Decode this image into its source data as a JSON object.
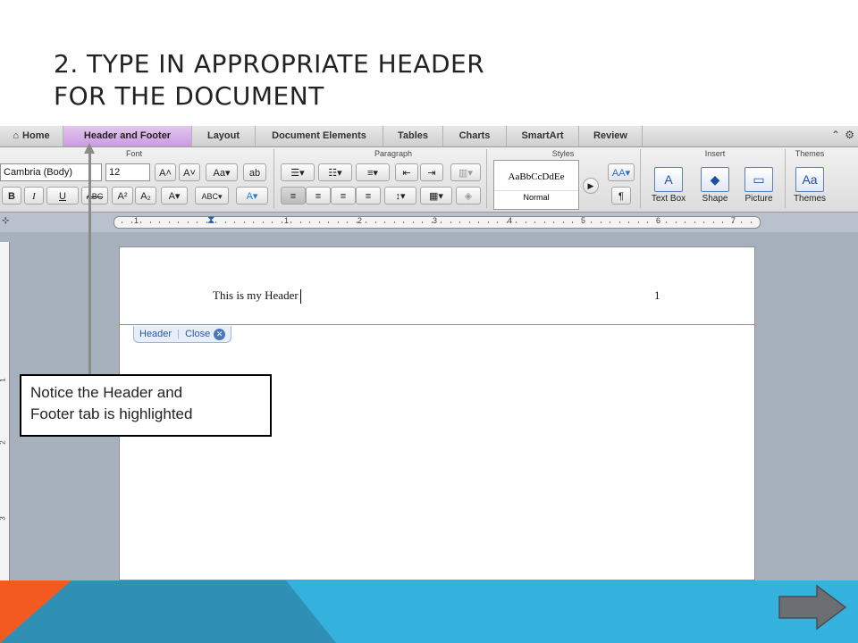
{
  "slide": {
    "title_line1": "2. TYPE IN APPROPRIATE HEADER",
    "title_line2": "FOR THE DOCUMENT"
  },
  "tabs": [
    {
      "label": "Home"
    },
    {
      "label": "Header and Footer",
      "active": true
    },
    {
      "label": "Layout"
    },
    {
      "label": "Document Elements"
    },
    {
      "label": "Tables"
    },
    {
      "label": "Charts"
    },
    {
      "label": "SmartArt"
    },
    {
      "label": "Review"
    }
  ],
  "ribbon": {
    "groups": {
      "font": "Font",
      "paragraph": "Paragraph",
      "styles": "Styles",
      "insert": "Insert",
      "themes": "Themes"
    },
    "font_name": "Cambria (Body)",
    "font_size": "12",
    "style_preview": "AaBbCcDdEe",
    "style_name": "Normal",
    "insert_buttons": {
      "text_box": "Text Box",
      "shape": "Shape",
      "picture": "Picture"
    },
    "themes_button": "Themes",
    "format_buttons": {
      "bold": "B",
      "italic": "I",
      "underline": "U",
      "strike": "ABC",
      "superscript": "A²",
      "subscript": "A₂"
    }
  },
  "ruler_numbers": [
    "1",
    "1",
    "2",
    "3",
    "4",
    "5",
    "6",
    "7"
  ],
  "vruler_numbers": [
    "1",
    "2",
    "3"
  ],
  "document": {
    "header_text": "This is my Header",
    "page_number": "1",
    "header_tag_label": "Header",
    "close_label": "Close"
  },
  "callout": {
    "line1": "Notice the Header and",
    "line2": "Footer tab is highlighted"
  },
  "colors": {
    "active_tab": "#c99be0",
    "footer_orange": "#f25a22",
    "footer_teal": "#2f8fb5",
    "footer_blue": "#35b1de",
    "next_arrow": "#6b6f73"
  }
}
